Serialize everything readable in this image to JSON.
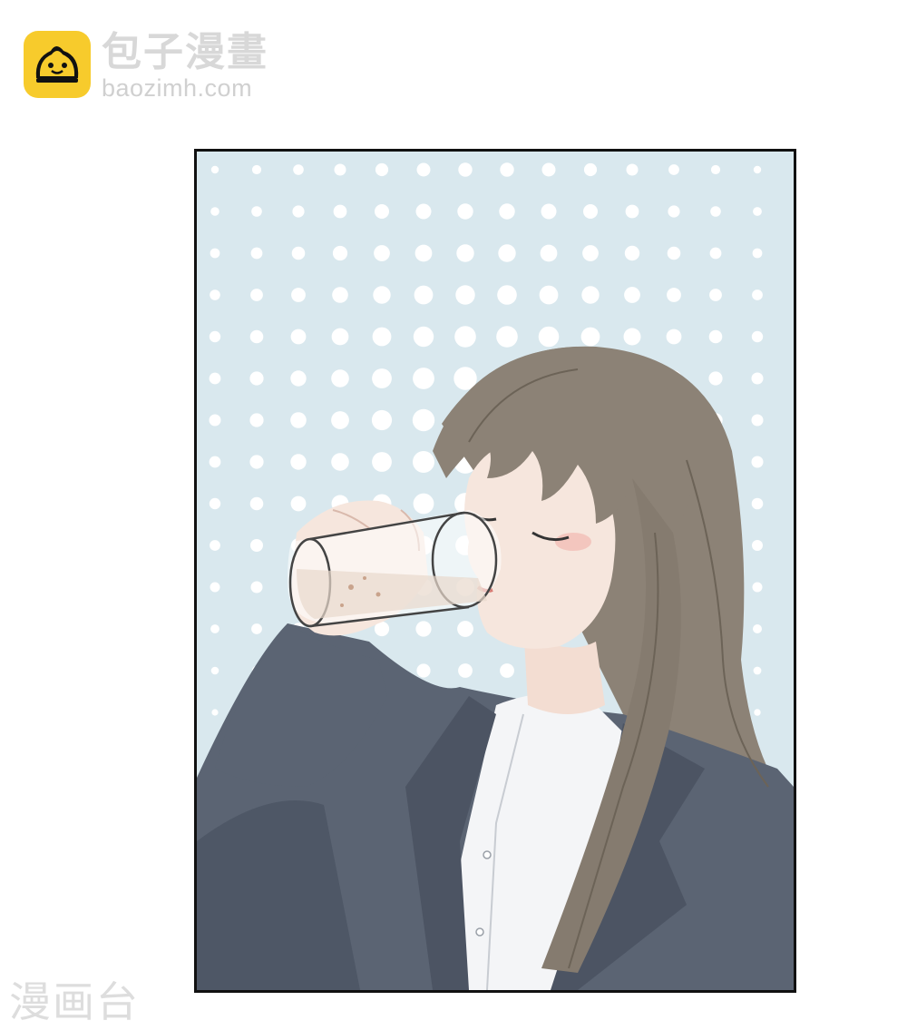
{
  "logo": {
    "icon": "bun-mascot-icon",
    "name": "包子漫畫",
    "url": "baozimh.com"
  },
  "panel": {
    "scene": "manga-panel-girl-drinking-water",
    "colors": {
      "background": "#d9e8ee",
      "dots": "#ffffff",
      "hair": "#8c8276",
      "jacket": "#5b6473",
      "shirt": "#f4f5f7",
      "skin": "#f6e6dd",
      "border": "#111111"
    }
  },
  "watermark": {
    "text": "漫画台"
  }
}
